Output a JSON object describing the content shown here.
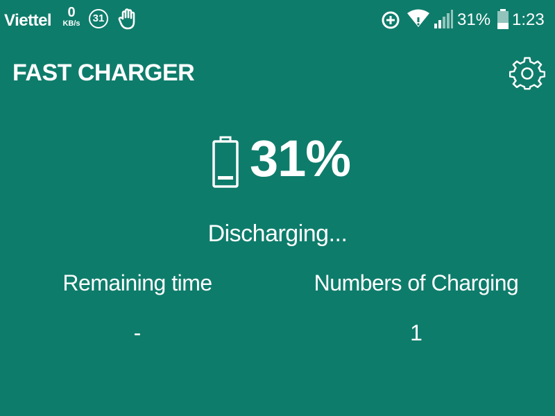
{
  "status_bar": {
    "carrier": "Viettel",
    "net_speed_value": "0",
    "net_speed_unit": "KB/s",
    "notification_count": "31",
    "battery_percent": "31%",
    "time": "1:23",
    "icons": [
      "hand-icon",
      "data-saver-icon",
      "wifi-icon",
      "signal-icon",
      "battery-icon"
    ]
  },
  "app_bar": {
    "title": "FAST CHARGER",
    "settings_icon": "gear-icon"
  },
  "battery": {
    "percent_text": "31%",
    "level": 0.31,
    "status": "Discharging..."
  },
  "stats": {
    "remaining_time_label": "Remaining time",
    "remaining_time_value": "-",
    "charging_count_label": "Numbers of Charging",
    "charging_count_value": "1"
  },
  "colors": {
    "background": "#0e7c6b",
    "foreground": "#ffffff"
  }
}
